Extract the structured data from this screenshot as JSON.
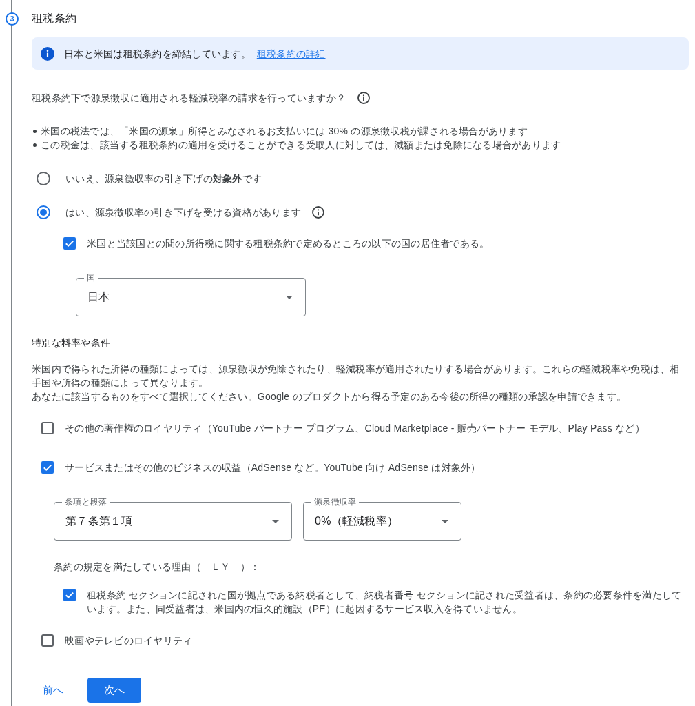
{
  "step": {
    "number": "3",
    "title": "租税条約"
  },
  "info_banner": {
    "text": "日本と米国は租税条約を締結しています。",
    "link": "租税条約の詳細"
  },
  "question": {
    "text": "租税条約下で源泉徴収に適用される軽減税率の請求を行っていますか？"
  },
  "notes": [
    "米国の税法では、「米国の源泉」所得とみなされるお支払いには 30% の源泉徴収税が課される場合があります",
    "この税金は、該当する租税条約の適用を受けることができる受取人に対しては、減額または免除になる場合があります"
  ],
  "options": [
    {
      "label": "いいえ、源泉徴収率の引き下げの**対象外**です",
      "selected": false,
      "info": false
    },
    {
      "label": "はい、源泉徴収率の引き下げを受ける資格があります",
      "selected": true,
      "info": true
    }
  ],
  "residency": {
    "label": "米国と当該国との間の所得税に関する租税条約で定めるところの以下の国の居住者である。",
    "checked": true
  },
  "country": {
    "label": "国",
    "value": "日本"
  },
  "special_rates": {
    "heading": "特別な料率や条件",
    "paragraphs": [
      "米国内で得られた所得の種類によっては、源泉徴収が免除されたり、軽減税率が適用されたりする場合があります。これらの軽減税率や免税は、相手国や所得の種類によって異なります。",
      "あなたに該当するものをすべて選択してください。Google のプロダクトから得る予定のある今後の所得の種類の承認を申請できます。"
    ]
  },
  "income_types": [
    {
      "label": "その他の著作権のロイヤリティ（YouTube パートナー プログラム、Cloud Marketplace - 販売パートナー モデル、Play Pass など）",
      "checked": false
    },
    {
      "label": "サービスまたはその他のビジネスの収益（AdSense など。YouTube 向け AdSense は対象外）",
      "checked": true,
      "details": {
        "selects": [
          {
            "label": "条項と段落",
            "value": "第７条第１項"
          },
          {
            "label": "源泉徴収率",
            "value": "0%（軽減税率）"
          }
        ],
        "reason": {
          "heading": "条約の規定を満たしている理由（　ＬＹ　）：",
          "label": "租税条約 セクションに記された国が拠点である納税者として、納税者番号 セクションに記された受益者は、条約の必要条件を満たしています。また、同受益者は、米国内の恒久的施設（PE）に起因するサービス収入を得ていません。",
          "checked": true
        }
      }
    },
    {
      "label": "映画やテレビのロイヤリティ",
      "checked": false
    }
  ],
  "buttons": [
    {
      "label": "前へ",
      "kind": "text"
    },
    {
      "label": "次へ",
      "kind": "filled"
    }
  ]
}
